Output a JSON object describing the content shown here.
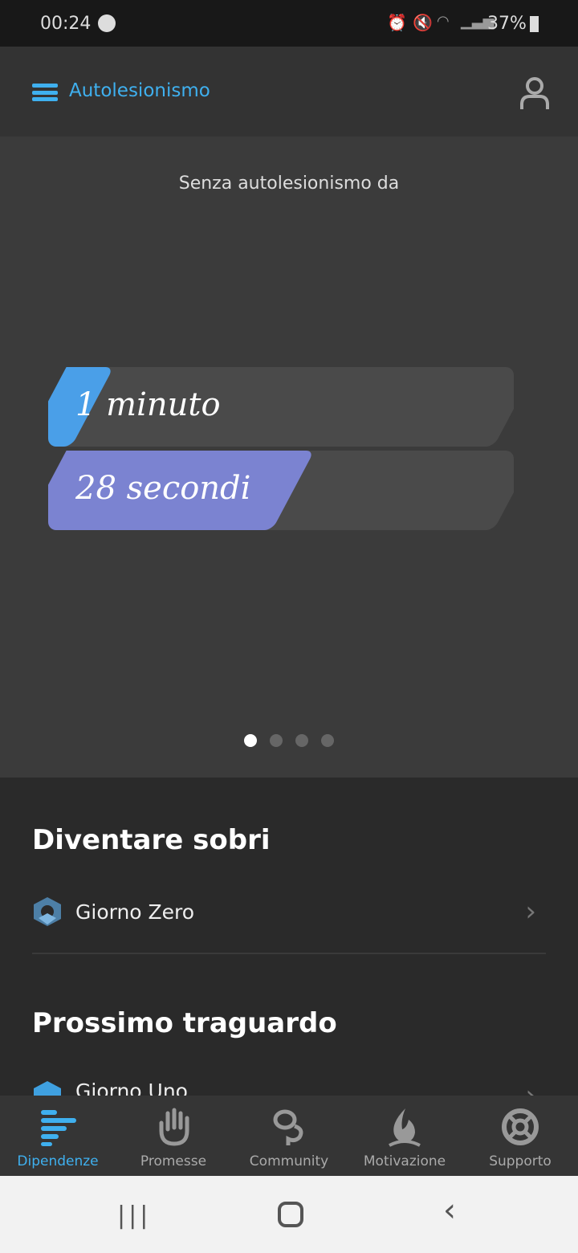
{
  "status_bar": {
    "time": "00:24",
    "battery": "37%"
  },
  "app_bar": {
    "title": "Autolesionismo"
  },
  "hero": {
    "caption": "Senza autolesionismo da",
    "counters": [
      {
        "label": "1 minuto",
        "fill": 0.0167,
        "color": "#4a9fe8"
      },
      {
        "label": "28 secondi",
        "fill": 0.467,
        "color": "#7b83d1"
      }
    ],
    "pages": 4,
    "active_page": 0
  },
  "sections": [
    {
      "title": "Diventare sobri",
      "item": "Giorno Zero"
    },
    {
      "title": "Prossimo traguardo",
      "item": "Giorno Uno"
    }
  ],
  "bottom_nav": {
    "active": 0,
    "accent": "#3fb0ef",
    "items": [
      {
        "label": "Dipendenze",
        "icon": "bars-icon"
      },
      {
        "label": "Promesse",
        "icon": "hand-icon"
      },
      {
        "label": "Community",
        "icon": "chat-icon"
      },
      {
        "label": "Motivazione",
        "icon": "flame-icon"
      },
      {
        "label": "Supporto",
        "icon": "lifebuoy-icon"
      }
    ]
  }
}
